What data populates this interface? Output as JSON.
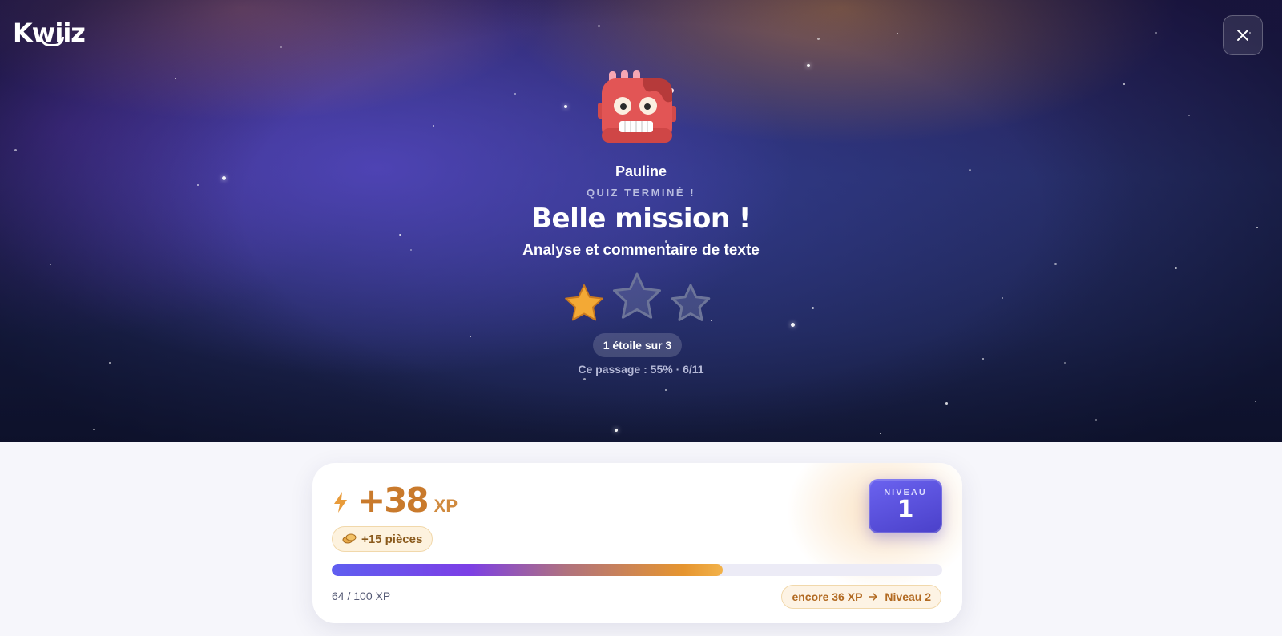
{
  "app": {
    "logo_text": "Kwiiz",
    "close_label": "×"
  },
  "player": {
    "name": "Pauline",
    "avatar": "red-robot-avatar"
  },
  "result": {
    "status": "QUIZ TERMINÉ !",
    "headline": "Belle mission !",
    "quiz_title": "Analyse et commentaire de texte",
    "stars_earned": 1,
    "stars_total": 3,
    "stars_label": "1 étoile sur 3",
    "run_stats": "Ce passage : 55% · 6/11"
  },
  "reward": {
    "xp_amount": "+38",
    "xp_unit": "XP",
    "coins_label": "+15 pièces",
    "level_label": "NIVEAU",
    "level_value": "1",
    "progress_fraction": 0.64,
    "xp_total": "64 / 100 XP",
    "remaining": "encore 36 XP",
    "next_level": "Niveau 2"
  },
  "colors": {
    "accent_gold": "#c97a2c",
    "level_badge": "#5b52e0",
    "star_filled": "#f3a935",
    "star_empty": "#6d7599"
  },
  "icons": {
    "close": "close-icon",
    "bolt": "lightning-bolt-icon",
    "coins": "coins-icon",
    "arrow": "arrow-right-icon",
    "star": "star-icon"
  }
}
